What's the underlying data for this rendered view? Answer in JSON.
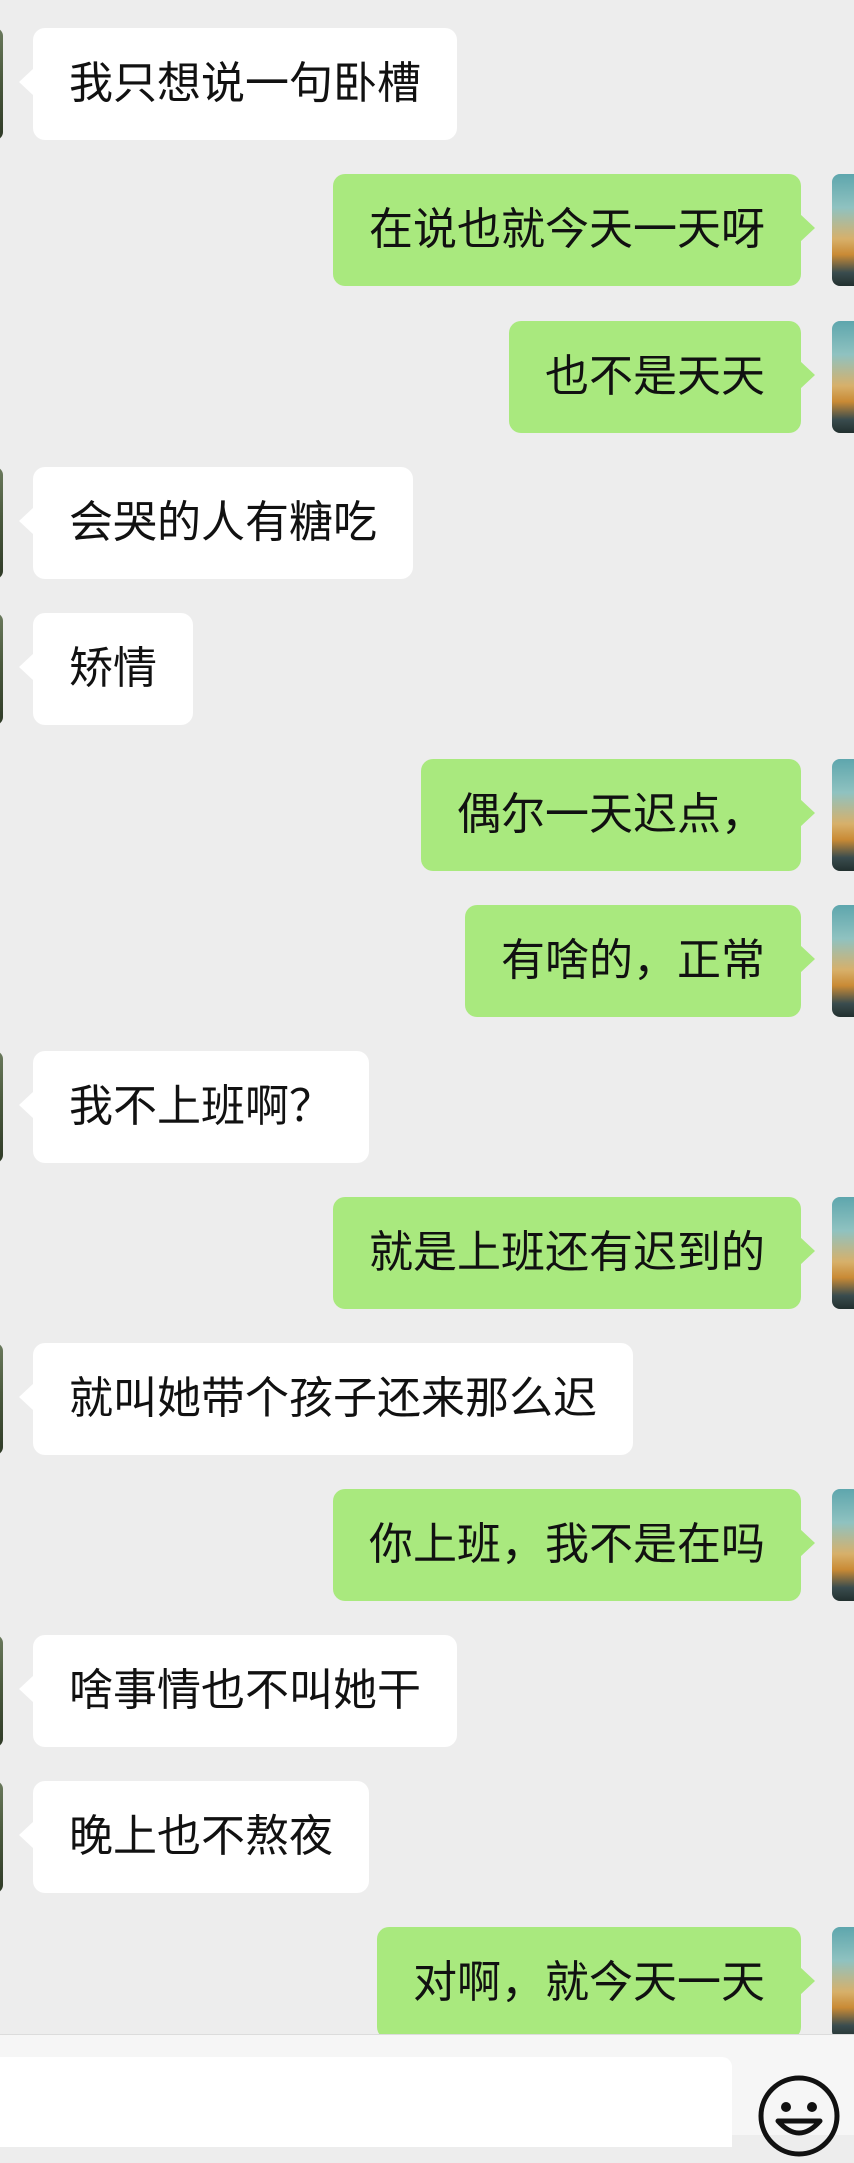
{
  "messages": [
    {
      "side": "in",
      "text": "我只想说一句卧槽"
    },
    {
      "side": "out",
      "text": "在说也就今天一天呀"
    },
    {
      "side": "out",
      "text": "也不是天天"
    },
    {
      "side": "in",
      "text": "会哭的人有糖吃"
    },
    {
      "side": "in",
      "text": "矫情"
    },
    {
      "side": "out",
      "text": "偶尔一天迟点，"
    },
    {
      "side": "out",
      "text": "有啥的，正常"
    },
    {
      "side": "in",
      "text": "我不上班啊？"
    },
    {
      "side": "out",
      "text": "就是上班还有迟到的"
    },
    {
      "side": "in",
      "text": "就叫她带个孩子还来那么迟"
    },
    {
      "side": "out",
      "text": "你上班，我不是在吗"
    },
    {
      "side": "in",
      "text": "啥事情也不叫她干"
    },
    {
      "side": "in",
      "text": "晚上也不熬夜"
    },
    {
      "side": "out",
      "text": "对啊，就今天一天"
    }
  ],
  "input": {
    "value": "",
    "emoji_icon": "emoji-icon"
  },
  "colors": {
    "background": "#ededed",
    "incoming_bubble": "#ffffff",
    "outgoing_bubble": "#a9e97e",
    "input_bar": "#f6f6f6"
  }
}
